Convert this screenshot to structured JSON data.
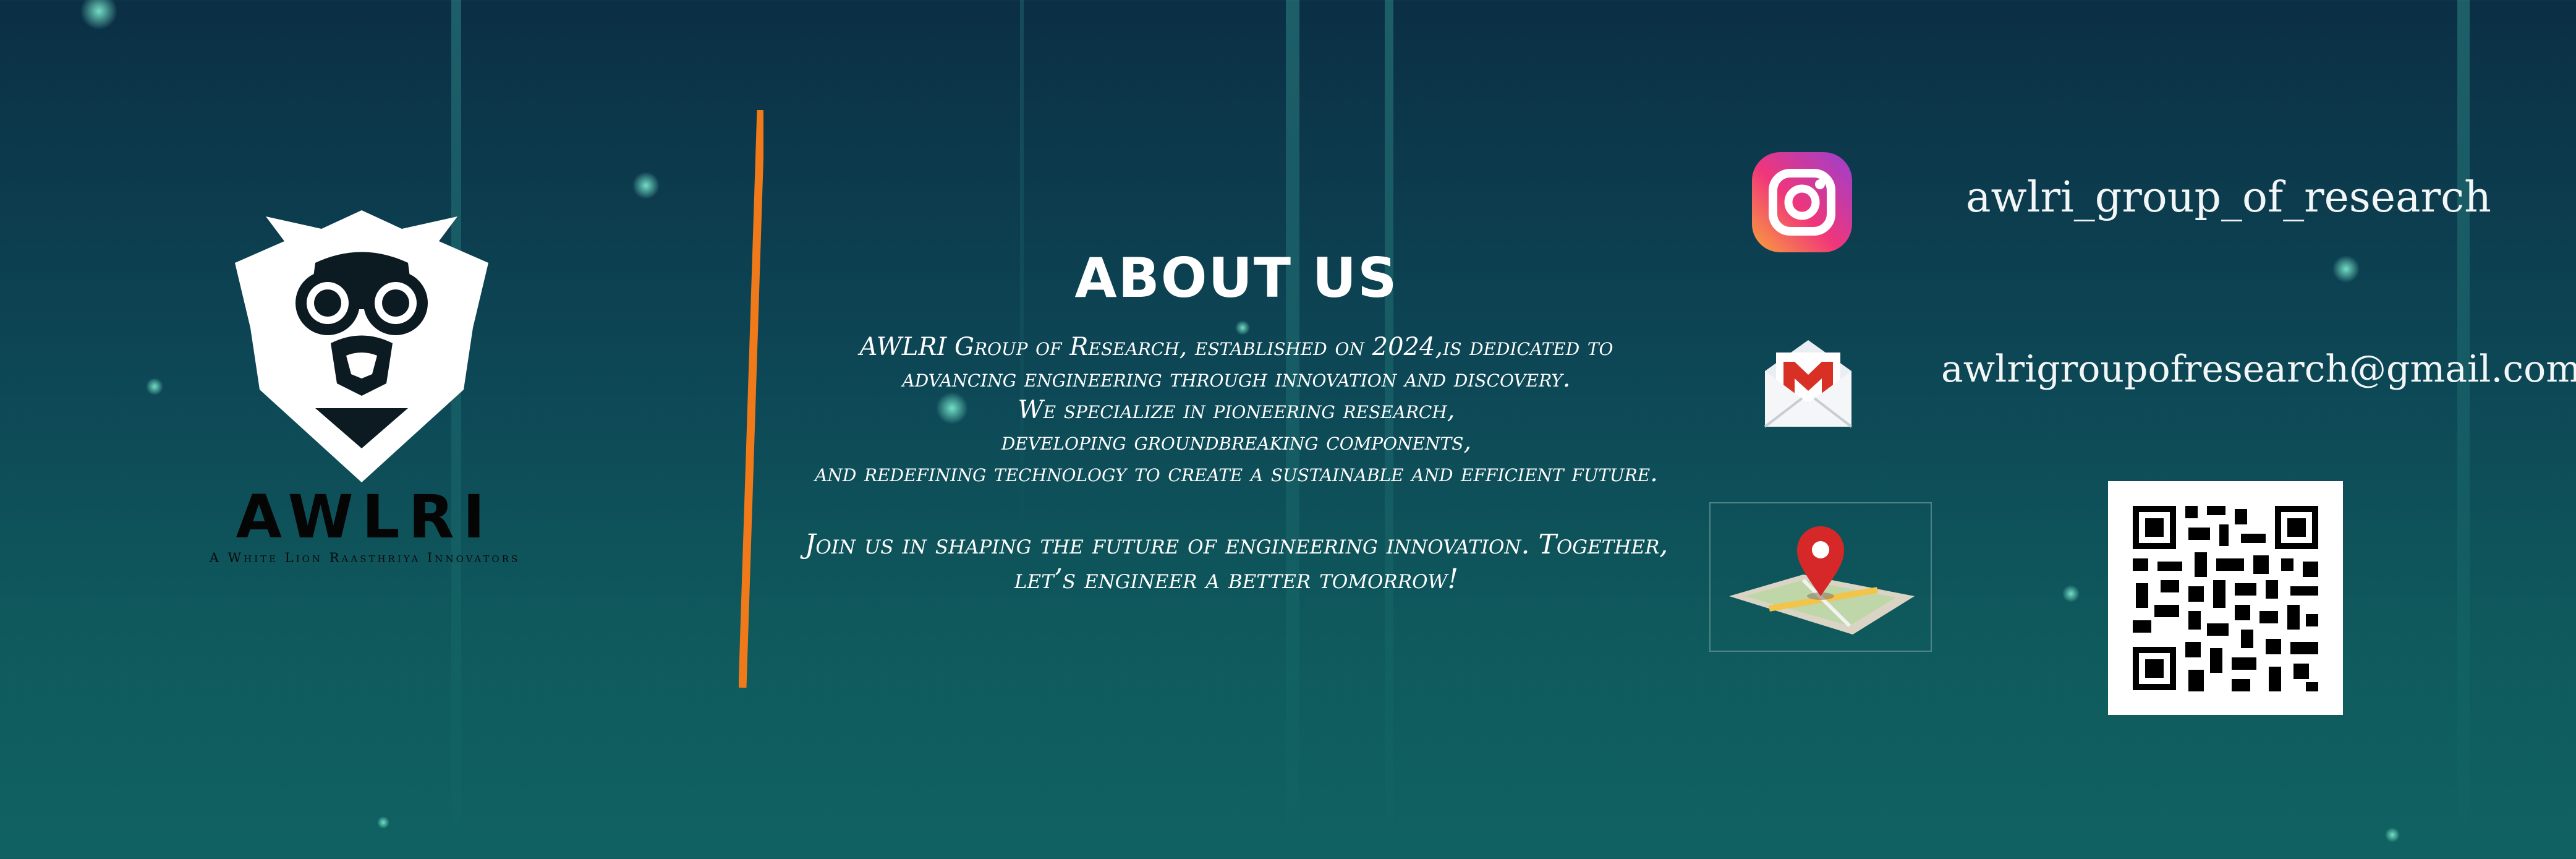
{
  "brand": {
    "name": "AWLRI",
    "tagline": "A White Lion Raasthriya Innovators"
  },
  "about": {
    "heading": "ABOUT US",
    "intro_lines": [
      "AWLRI Group of Research, established on  2024,is dedicated to",
      "advancing engineering through innovation and discovery.",
      "We specialize in pioneering research,",
      "developing groundbreaking components,",
      "and redefining technology to create a sustainable and efficient future."
    ],
    "closing_lines": [
      "Join us in shaping the future of engineering innovation. Together,",
      "let’s engineer a better tomorrow!"
    ]
  },
  "contacts": {
    "instagram": {
      "icon": "instagram-icon",
      "handle": "awlri_group_of_research"
    },
    "email": {
      "icon": "gmail-icon",
      "address": "awlrigroupofresearch@gmail.com"
    },
    "location": {
      "icon": "map-pin-icon"
    },
    "qr": {
      "icon": "qr-code"
    }
  },
  "colors": {
    "background_top": "#0b2f45",
    "background_bottom": "#106262",
    "divider": "#f07a1a",
    "text": "#ffffff",
    "logo": "#ffffff"
  }
}
